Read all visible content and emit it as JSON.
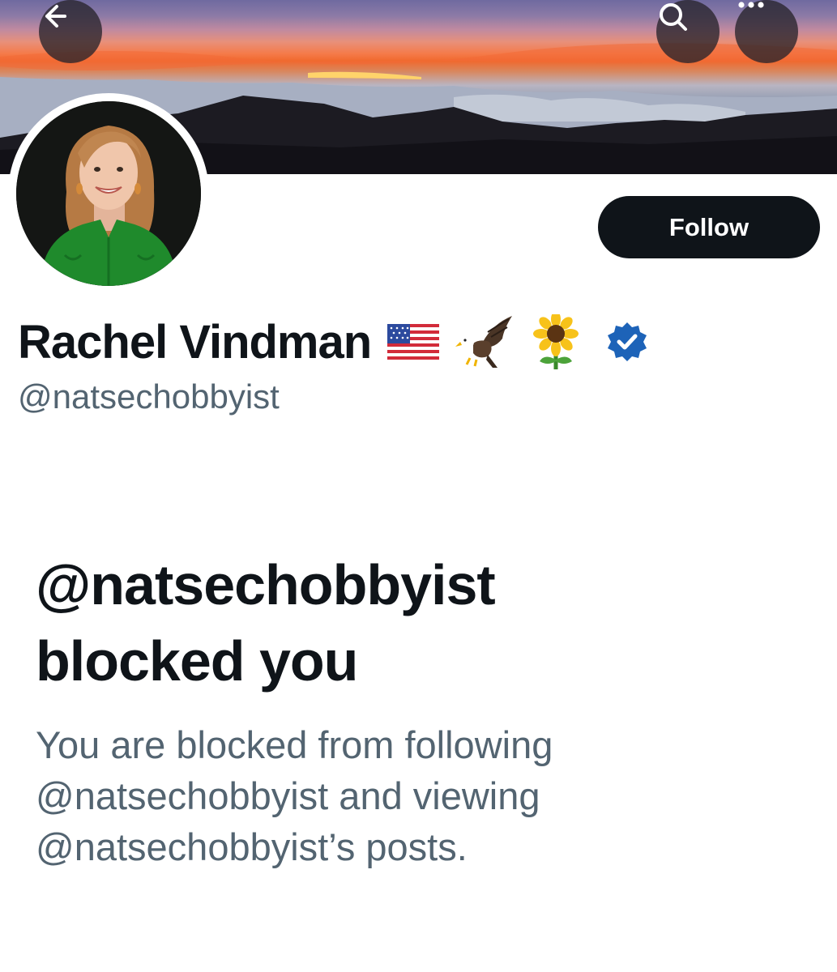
{
  "header": {
    "back_icon": "arrow-left-icon",
    "search_icon": "search-icon",
    "more_icon": "ellipsis-icon"
  },
  "profile": {
    "display_name": "Rachel Vindman",
    "name_emojis": [
      "us-flag-emoji",
      "eagle-emoji",
      "sunflower-emoji"
    ],
    "verified_badge": "verified-badge-icon",
    "handle": "@natsechobbyist",
    "follow_label": "Follow"
  },
  "blocked_notice": {
    "title_line1": "@natsechobbyist",
    "title_line2": "blocked you",
    "desc_line1": "You are blocked from following",
    "desc_line2": "@natsechobbyist and viewing",
    "desc_line3": "@natsechobbyist’s posts."
  },
  "colors": {
    "text_primary": "#0f1419",
    "text_secondary": "#536471",
    "follow_button_bg": "#0f1419",
    "verified_blue": "#1d63b8",
    "overlay_button_bg": "#28242c"
  }
}
